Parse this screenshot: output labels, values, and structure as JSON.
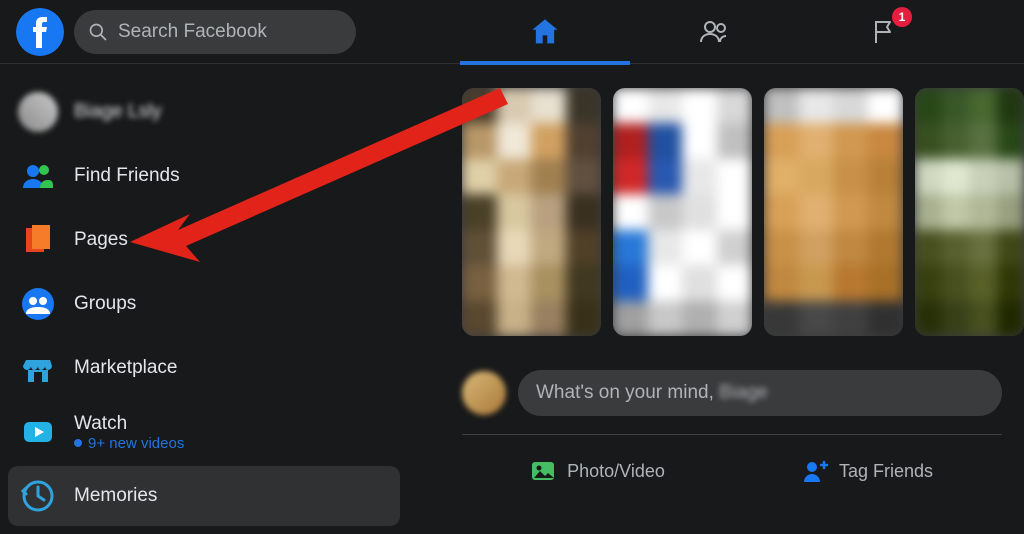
{
  "header": {
    "search_placeholder": "Search Facebook",
    "badge_count": "1"
  },
  "sidebar": {
    "items": [
      {
        "label": "Biage Lsly",
        "icon": "profile"
      },
      {
        "label": "Find Friends",
        "icon": "friends"
      },
      {
        "label": "Pages",
        "icon": "pages"
      },
      {
        "label": "Groups",
        "icon": "groups"
      },
      {
        "label": "Marketplace",
        "icon": "marketplace"
      },
      {
        "label": "Watch",
        "icon": "watch",
        "sub": "9+ new videos"
      },
      {
        "label": "Memories",
        "icon": "memories"
      }
    ]
  },
  "composer": {
    "placeholder": "What's on your mind, ",
    "user_first": "Biage",
    "photo_video": "Photo/Video",
    "tag_friends": "Tag Friends"
  },
  "annotation": {
    "target": "Pages"
  }
}
